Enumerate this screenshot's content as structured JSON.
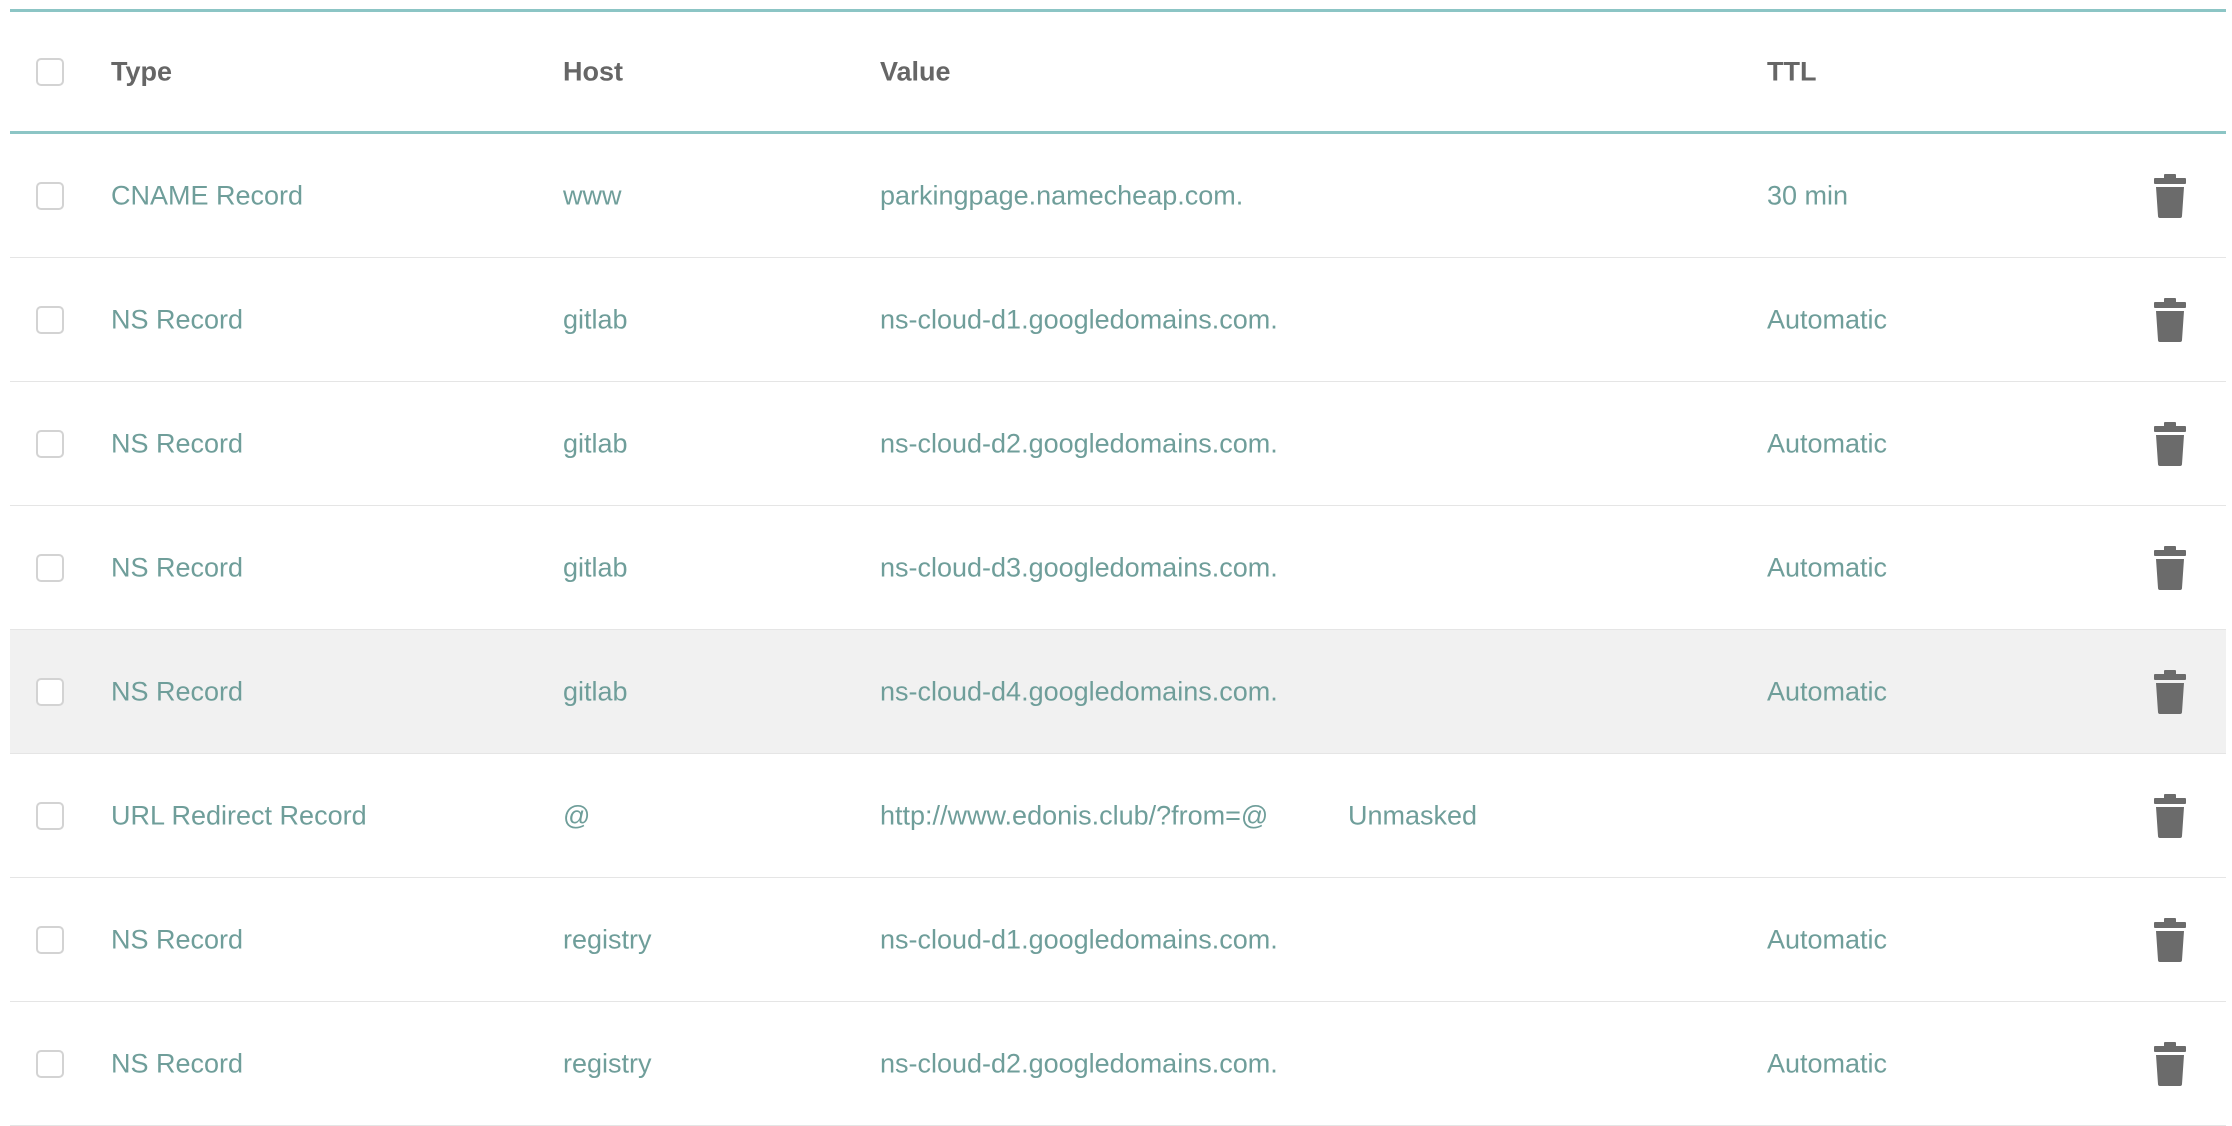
{
  "header": {
    "type": "Type",
    "host": "Host",
    "value": "Value",
    "ttl": "TTL"
  },
  "records": [
    {
      "type": "CNAME Record",
      "host": "www",
      "value": "parkingpage.namecheap.com.",
      "ttl": "30 min",
      "masking": ""
    },
    {
      "type": "NS Record",
      "host": "gitlab",
      "value": "ns-cloud-d1.googledomains.com.",
      "ttl": "Automatic",
      "masking": ""
    },
    {
      "type": "NS Record",
      "host": "gitlab",
      "value": "ns-cloud-d2.googledomains.com.",
      "ttl": "Automatic",
      "masking": ""
    },
    {
      "type": "NS Record",
      "host": "gitlab",
      "value": "ns-cloud-d3.googledomains.com.",
      "ttl": "Automatic",
      "masking": ""
    },
    {
      "type": "NS Record",
      "host": "gitlab",
      "value": "ns-cloud-d4.googledomains.com.",
      "ttl": "Automatic",
      "masking": ""
    },
    {
      "type": "URL Redirect Record",
      "host": "@",
      "value": "http://www.edonis.club/?from=@",
      "ttl": "",
      "masking": "Unmasked"
    },
    {
      "type": "NS Record",
      "host": "registry",
      "value": "ns-cloud-d1.googledomains.com.",
      "ttl": "Automatic",
      "masking": ""
    },
    {
      "type": "NS Record",
      "host": "registry",
      "value": "ns-cloud-d2.googledomains.com.",
      "ttl": "Automatic",
      "masking": ""
    }
  ],
  "icons": {
    "row_delete": "trash-icon",
    "checkbox": "checkbox"
  },
  "colors": {
    "accent_border": "#8cc5c5",
    "record_text": "#6f9e9a",
    "header_text": "#666666",
    "hover_row_bg": "#f1f1f1",
    "trash_icon": "#6b6b6b"
  }
}
